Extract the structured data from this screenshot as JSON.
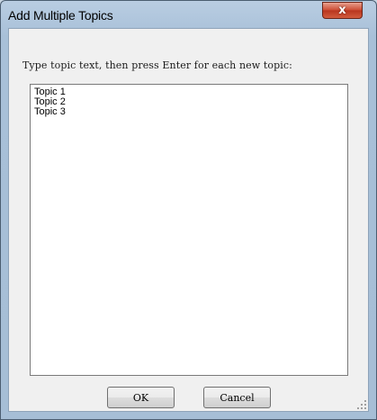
{
  "window": {
    "title": "Add Multiple Topics",
    "close_glyph": "x"
  },
  "dialog": {
    "instruction": "Type topic text, then press Enter for each new topic:",
    "topics": [
      "Topic 1",
      "Topic 2",
      "Topic 3"
    ],
    "ok_label": "OK",
    "cancel_label": "Cancel"
  },
  "icons": {
    "close": "close-icon"
  },
  "colors": {
    "titlebar": "#b9cde2",
    "close_button": "#cc4a31",
    "client_background": "#f0f0f0"
  }
}
